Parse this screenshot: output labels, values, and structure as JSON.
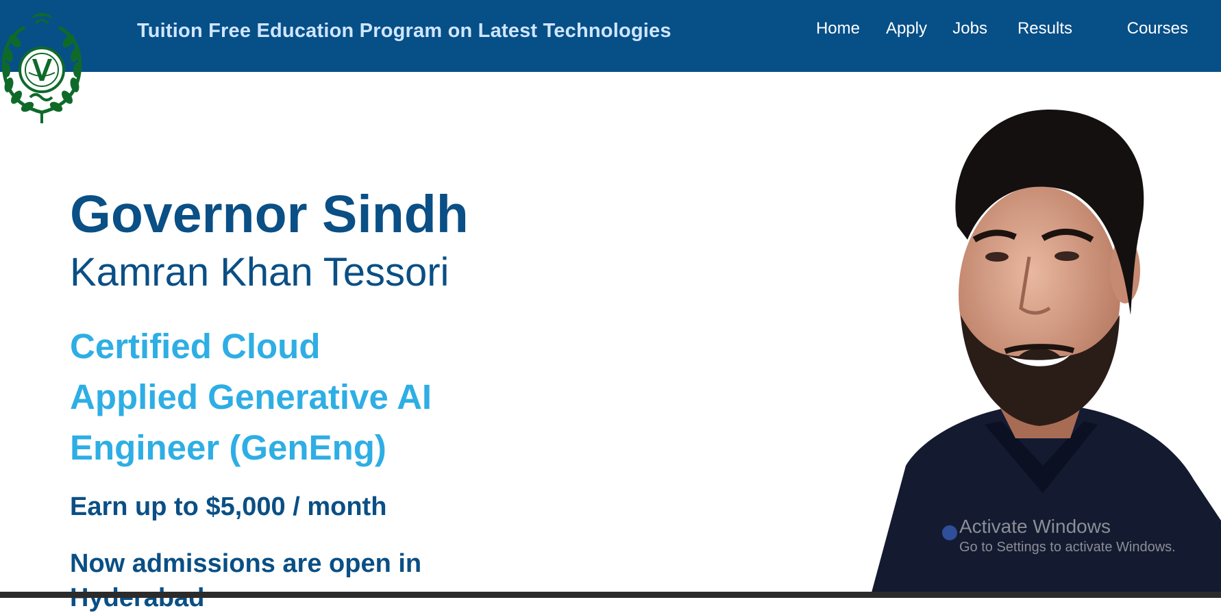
{
  "header": {
    "site_title": "Tuition Free Education Program on Latest Technologies",
    "background_color": "#074f87"
  },
  "logo": {
    "icon": "governor-sindh-emblem-icon",
    "color": "#0f6a2a"
  },
  "nav": {
    "items": [
      {
        "label": "Home"
      },
      {
        "label": "Apply"
      },
      {
        "label": "Jobs"
      },
      {
        "label": "Results"
      },
      {
        "label": "Courses"
      }
    ]
  },
  "hero": {
    "title": "Governor Sindh",
    "name": "Kamran Khan Tessori",
    "program_lines": [
      "Certified Cloud",
      "Applied Generative AI",
      "Engineer (GenEng)"
    ],
    "earn": "Earn up to $5,000 / month",
    "admissions": "Now admissions are open in",
    "admissions_next": "Hyderabad"
  },
  "portrait": {
    "icon": "portrait-photo-icon"
  },
  "watermark": {
    "title": "Activate Windows",
    "subtitle": "Go to Settings to activate Windows."
  },
  "colors": {
    "primary": "#0a4f85",
    "accent": "#2eaee4",
    "nav_text": "#ffffff",
    "title_text": "#cfe6ff"
  }
}
